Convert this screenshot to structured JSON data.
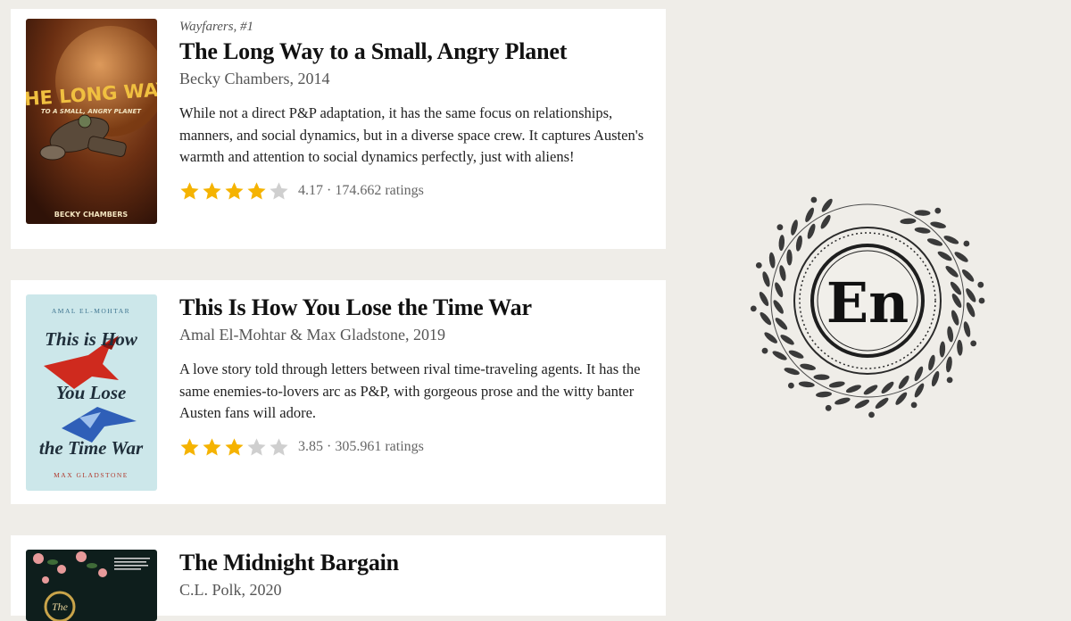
{
  "books": [
    {
      "series": "Wayfarers, #1",
      "title": "The Long Way to a Small, Angry Planet",
      "author": "Becky Chambers, 2014",
      "description": "While not a direct P&P adaptation, it has the same focus on relationships, manners, and social dynamics, but in a diverse space crew. It captures Austen's warmth and attention to social dynamics perfectly, just with aliens!",
      "rating": 4.17,
      "rating_text": "4.17 · 174.662 ratings",
      "cover": {
        "title_line1": "THE LONG WAY",
        "title_line2": "TO A SMALL, ANGRY PLANET",
        "author": "BECKY CHAMBERS"
      }
    },
    {
      "title": "This Is How You Lose the Time War",
      "author": "Amal El-Mohtar & Max Gladstone, 2019",
      "description": "A love story told through letters between rival time-traveling agents. It has the same enemies-to-lovers arc as P&P, with gorgeous prose and the witty banter Austen fans will adore.",
      "rating": 3.85,
      "rating_text": "3.85 · 305.961 ratings",
      "cover": {
        "author_top": "AMAL EL-MOHTAR",
        "line1": "This is How",
        "line2": "You Lose",
        "line3": "the Time War",
        "author_bottom": "MAX GLADSTONE"
      }
    },
    {
      "title": "The Midnight Bargain",
      "author": "C.L. Polk, 2020",
      "cover": {
        "letters": "The"
      }
    }
  ],
  "emblem": {
    "text": "En"
  },
  "colors": {
    "star_filled": "#f5b301",
    "star_empty": "#cfcfcf",
    "background": "#efede8"
  }
}
